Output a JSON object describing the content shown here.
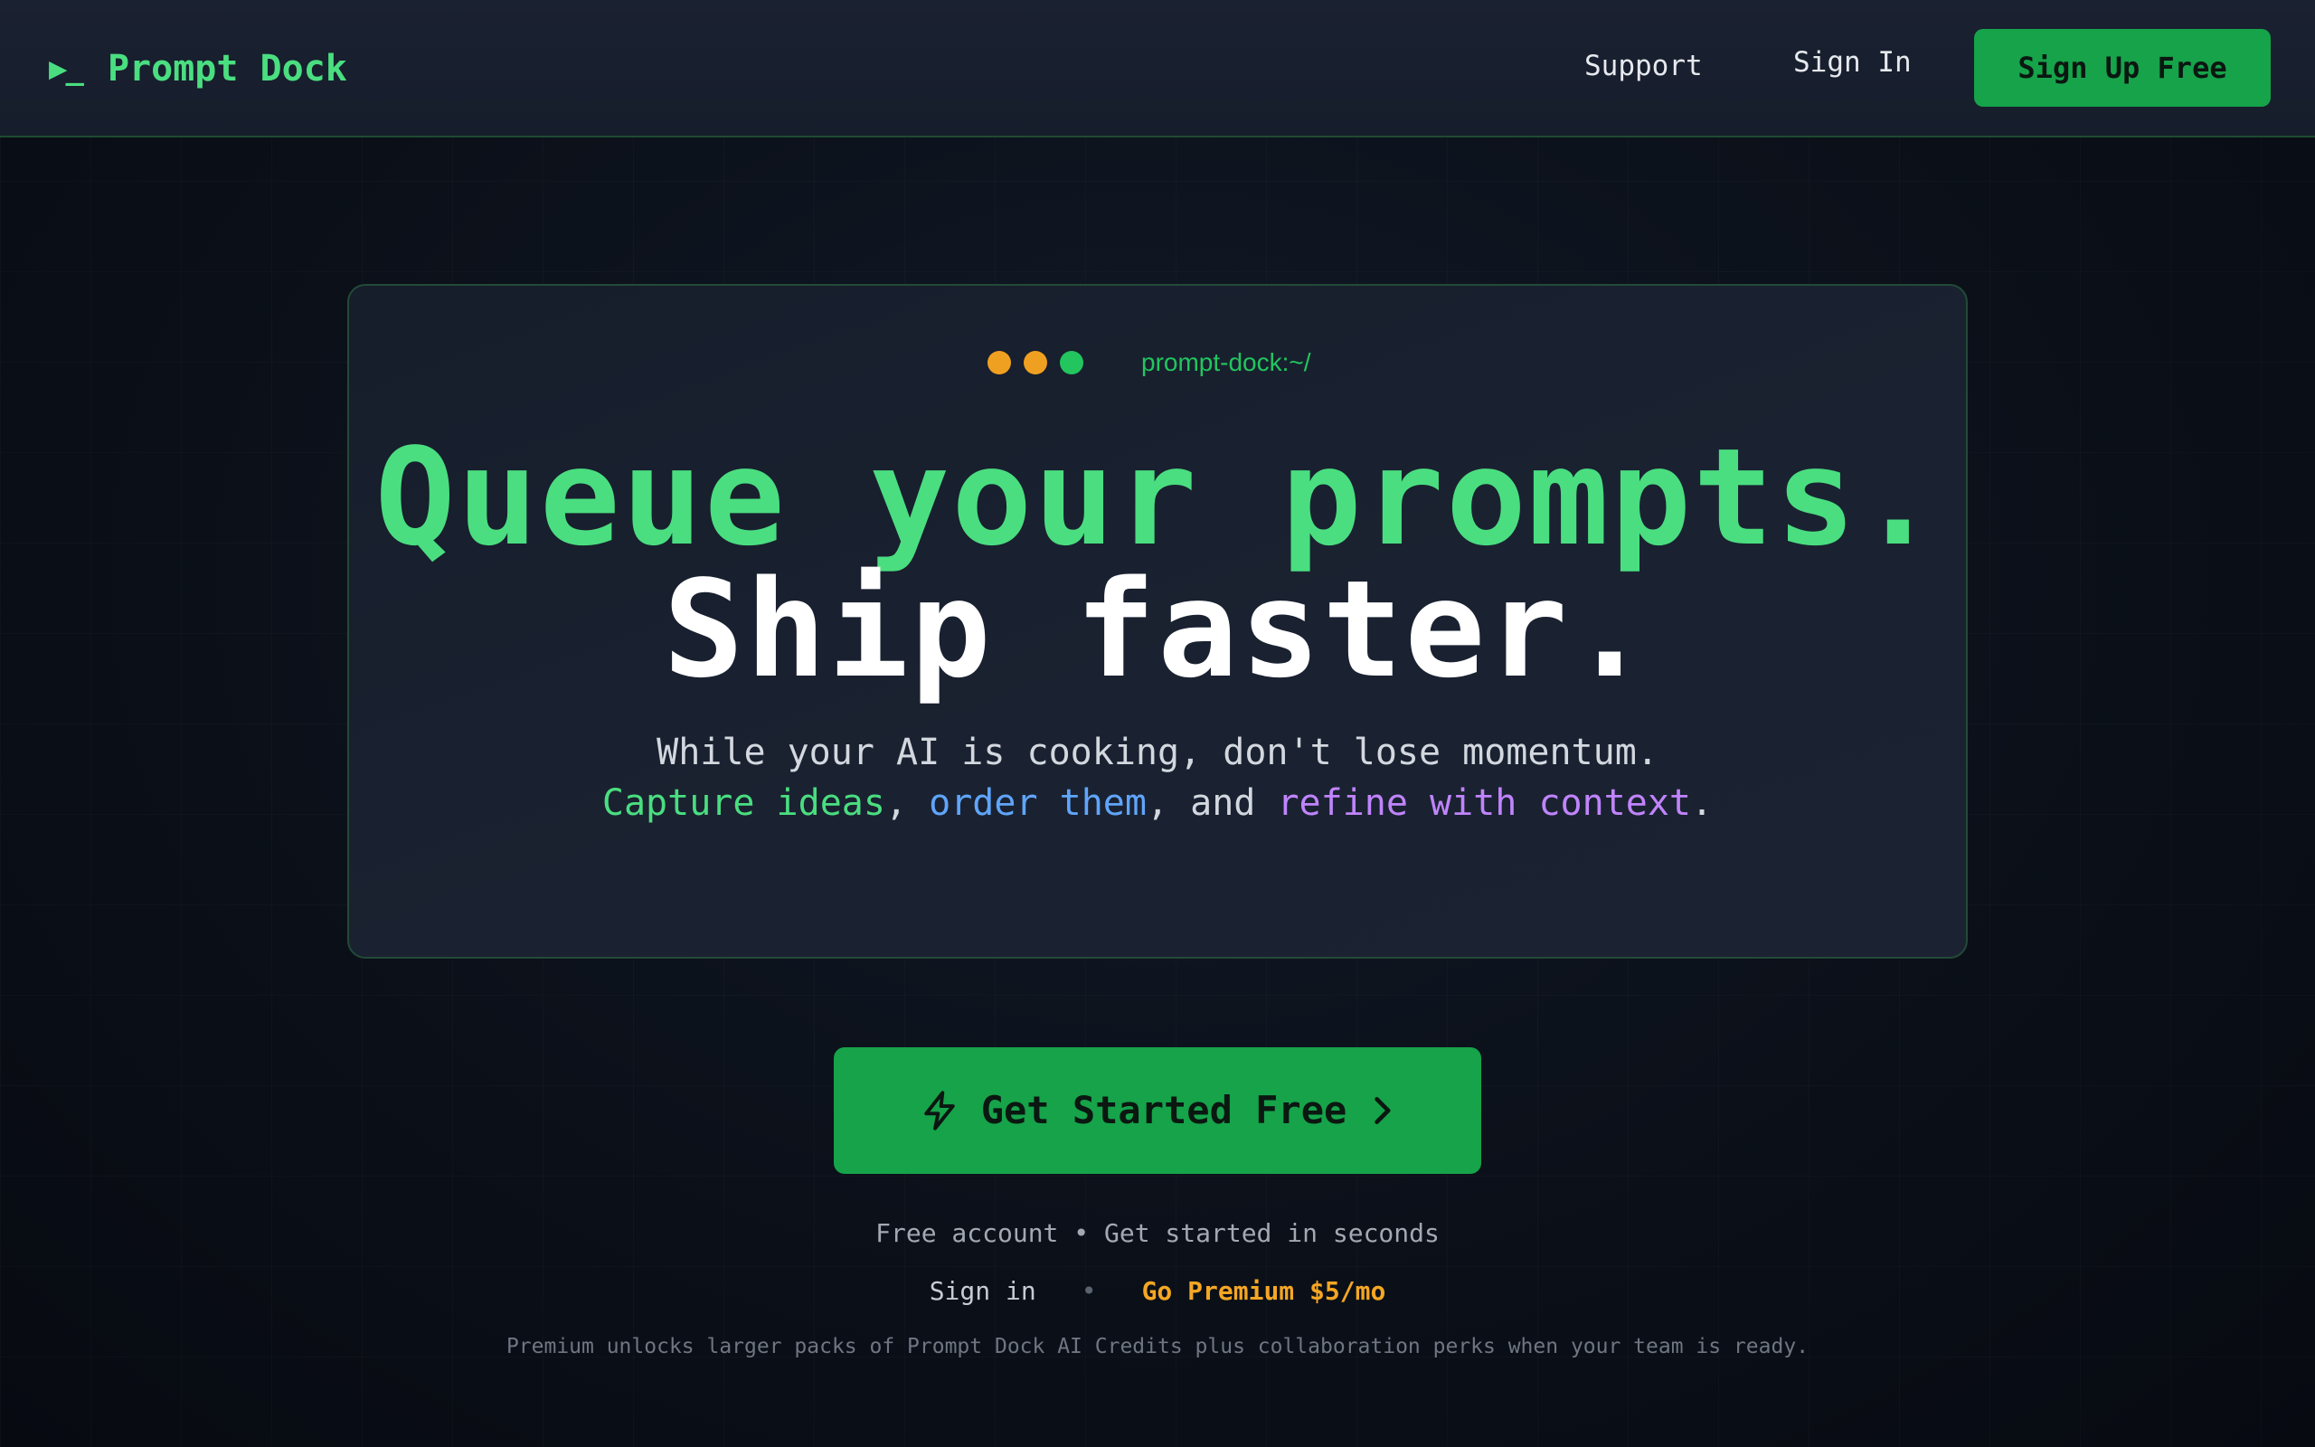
{
  "header": {
    "brand_icon": "▶_",
    "brand_name": "Prompt Dock",
    "nav": {
      "support": "Support",
      "sign_in": "Sign In"
    },
    "signup_label": "Sign Up Free"
  },
  "hero": {
    "window_path": "prompt-dock:~/",
    "headline_line1": "Queue your prompts.",
    "headline_line2": "Ship faster.",
    "subline_line1": "While your AI is cooking, don't lose momentum.",
    "subline_line2": {
      "part1": "Capture ideas",
      "sep1": ", ",
      "part2": "order them",
      "sep2": ", and ",
      "part3": "refine with context",
      "end": "."
    }
  },
  "cta": {
    "label": "Get Started Free",
    "icon_left": "lightning-icon",
    "icon_right": "chevron-right-icon"
  },
  "footer_notes": {
    "account_note": "Free account • Get started in seconds",
    "sign_in_link": "Sign in",
    "separator": "•",
    "premium_link": "Go Premium $5/mo",
    "premium_note": "Premium unlocks larger packs of Prompt Dock AI Credits plus collaboration perks when your team is ready."
  },
  "colors": {
    "accent_green": "#4ade80",
    "button_green": "#16a34a",
    "blue": "#60a5fa",
    "purple": "#c084fc",
    "premium_orange": "#f5a623",
    "dot_orange": "#f0a020",
    "dot_green": "#22c55e"
  }
}
